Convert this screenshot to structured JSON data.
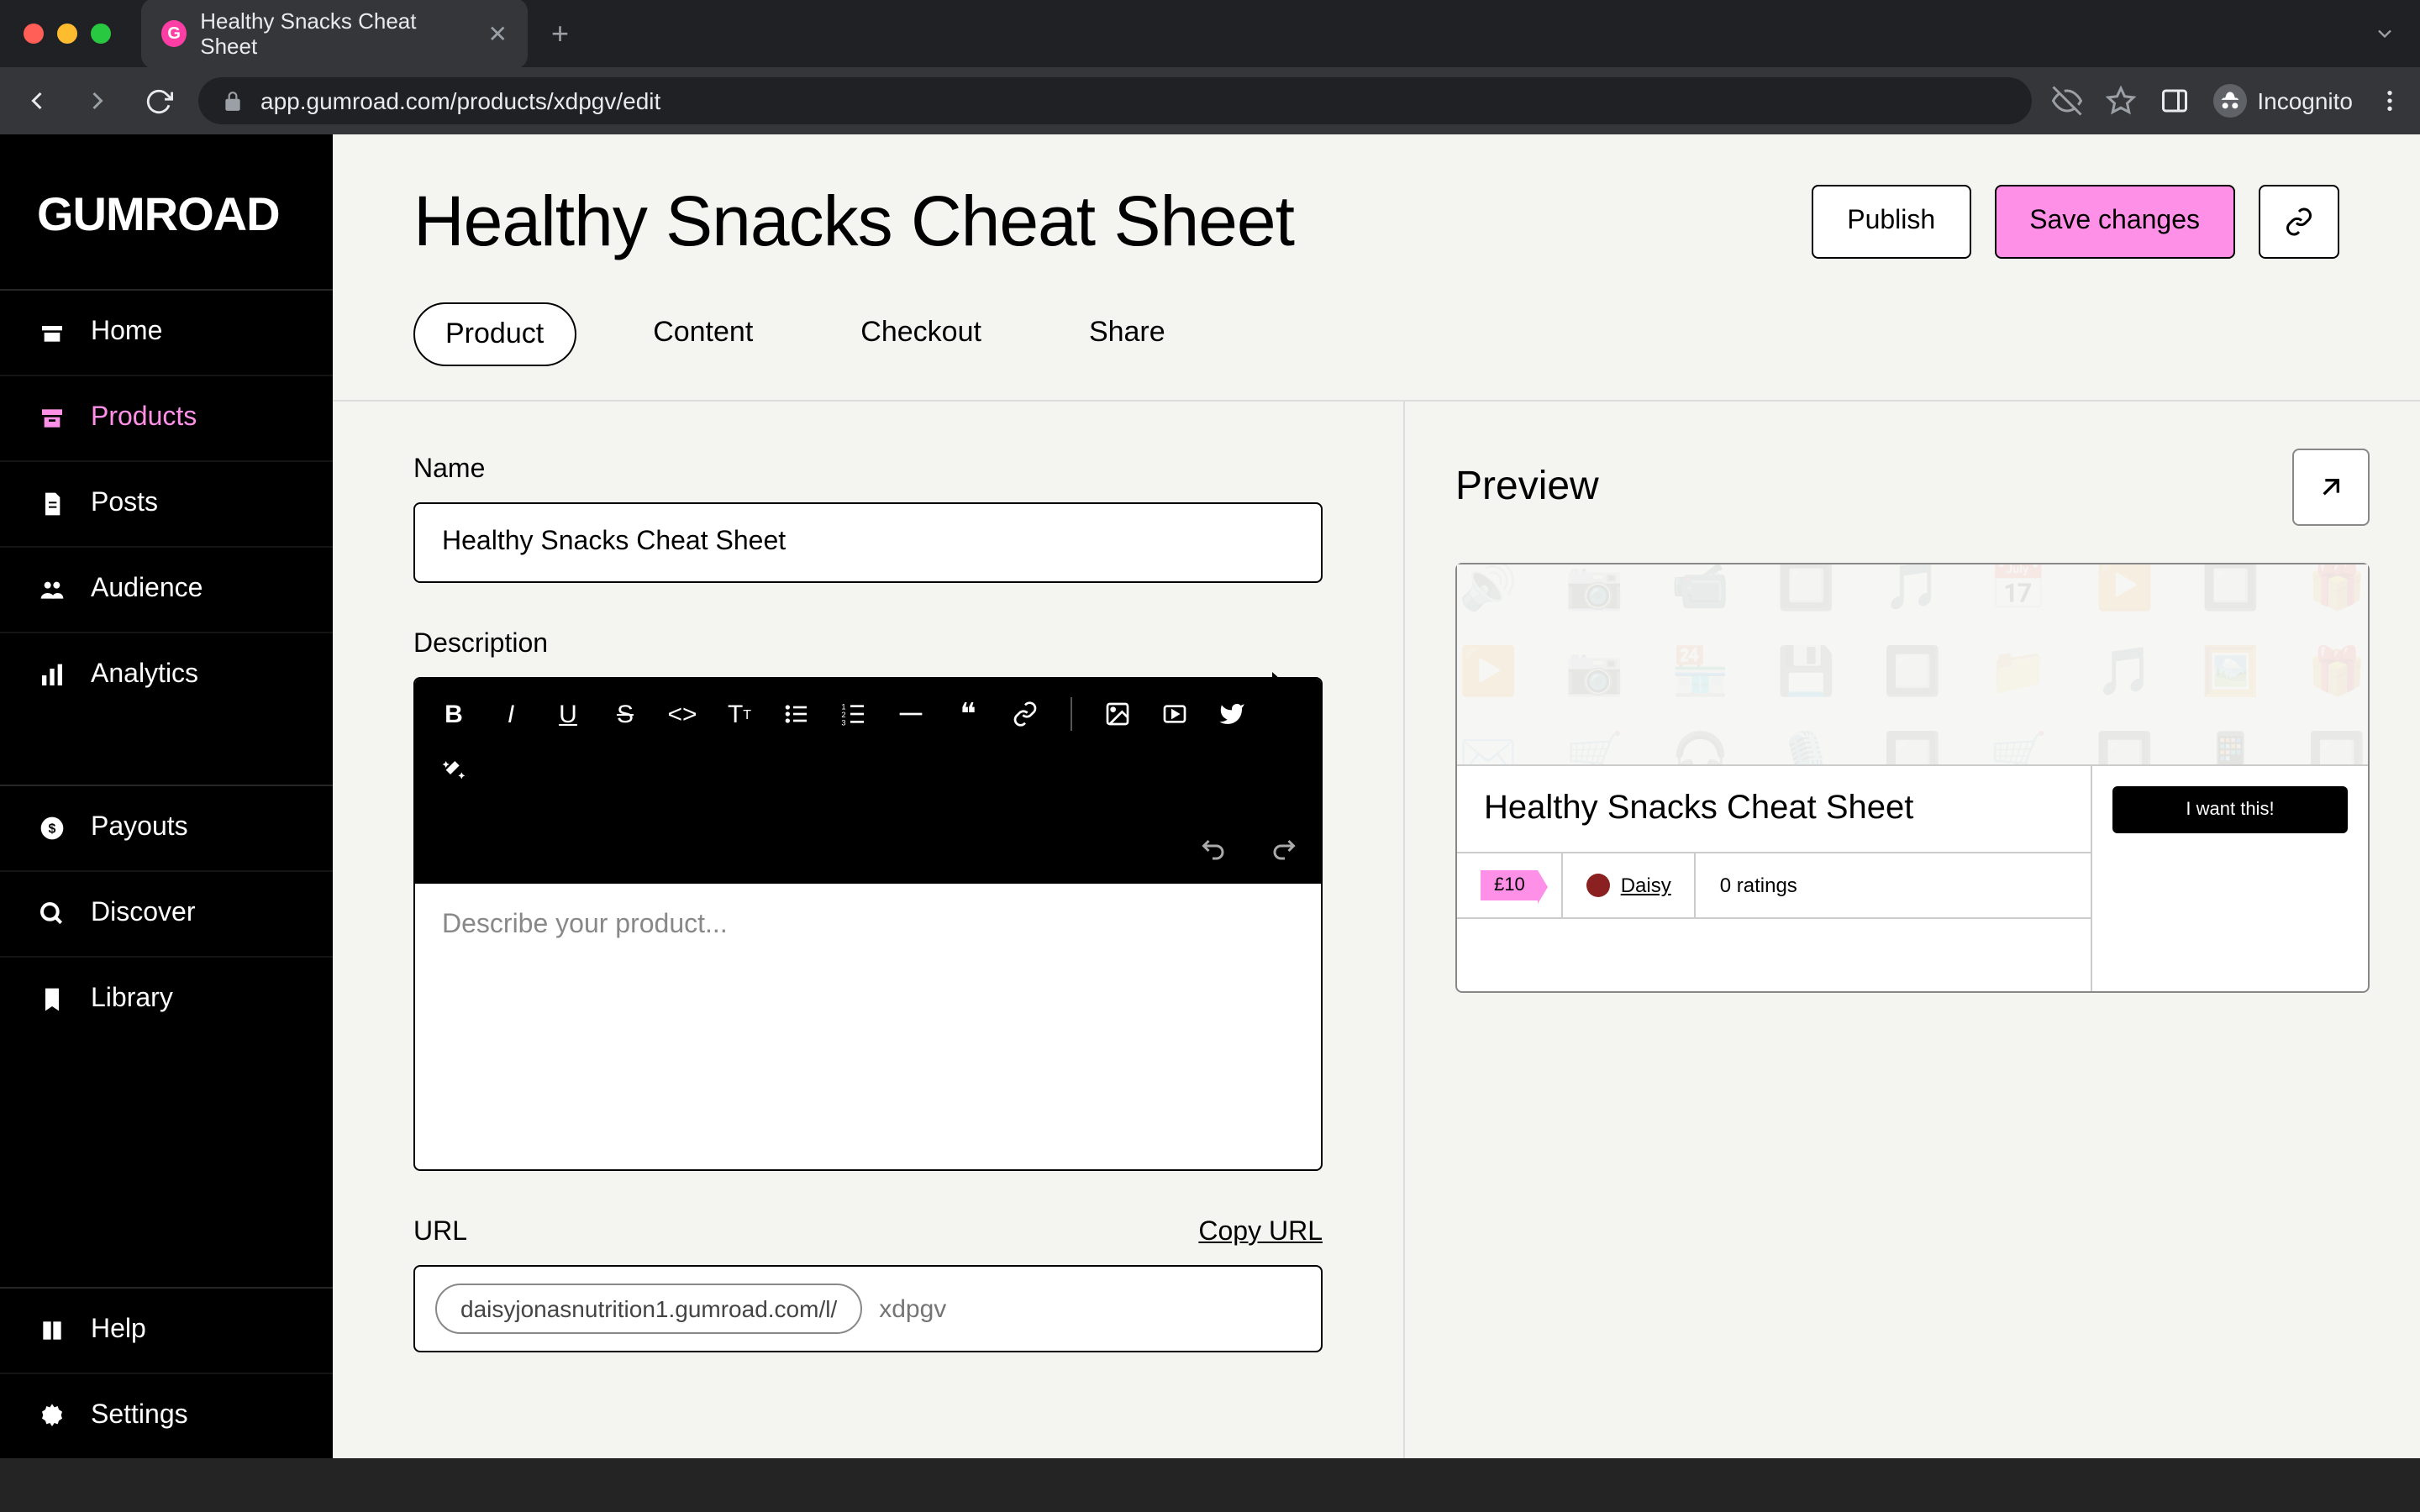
{
  "browser": {
    "tab_title": "Healthy Snacks Cheat Sheet",
    "url": "app.gumroad.com/products/xdpgv/edit",
    "incognito_label": "Incognito"
  },
  "sidebar": {
    "logo": "GUMROAD",
    "items": [
      {
        "label": "Home",
        "icon": "home"
      },
      {
        "label": "Products",
        "icon": "archive",
        "active": true
      },
      {
        "label": "Posts",
        "icon": "file"
      },
      {
        "label": "Audience",
        "icon": "users"
      },
      {
        "label": "Analytics",
        "icon": "bars"
      }
    ],
    "items2": [
      {
        "label": "Payouts",
        "icon": "dollar"
      },
      {
        "label": "Discover",
        "icon": "search"
      },
      {
        "label": "Library",
        "icon": "bookmark"
      }
    ],
    "items3": [
      {
        "label": "Help",
        "icon": "book"
      },
      {
        "label": "Settings",
        "icon": "gear"
      }
    ]
  },
  "header": {
    "title": "Healthy Snacks Cheat Sheet",
    "publish": "Publish",
    "save": "Save changes"
  },
  "tabs": [
    "Product",
    "Content",
    "Checkout",
    "Share"
  ],
  "form": {
    "name_label": "Name",
    "name_value": "Healthy Snacks Cheat Sheet",
    "desc_label": "Description",
    "desc_placeholder": "Describe your product...",
    "url_label": "URL",
    "copy_url": "Copy URL",
    "url_prefix": "daisyjonasnutrition1.gumroad.com/l/",
    "url_slug": "xdpgv"
  },
  "preview": {
    "heading": "Preview",
    "card_title": "Healthy Snacks Cheat Sheet",
    "price": "£10",
    "author": "Daisy",
    "ratings": "0 ratings",
    "cta": "I want this!"
  }
}
